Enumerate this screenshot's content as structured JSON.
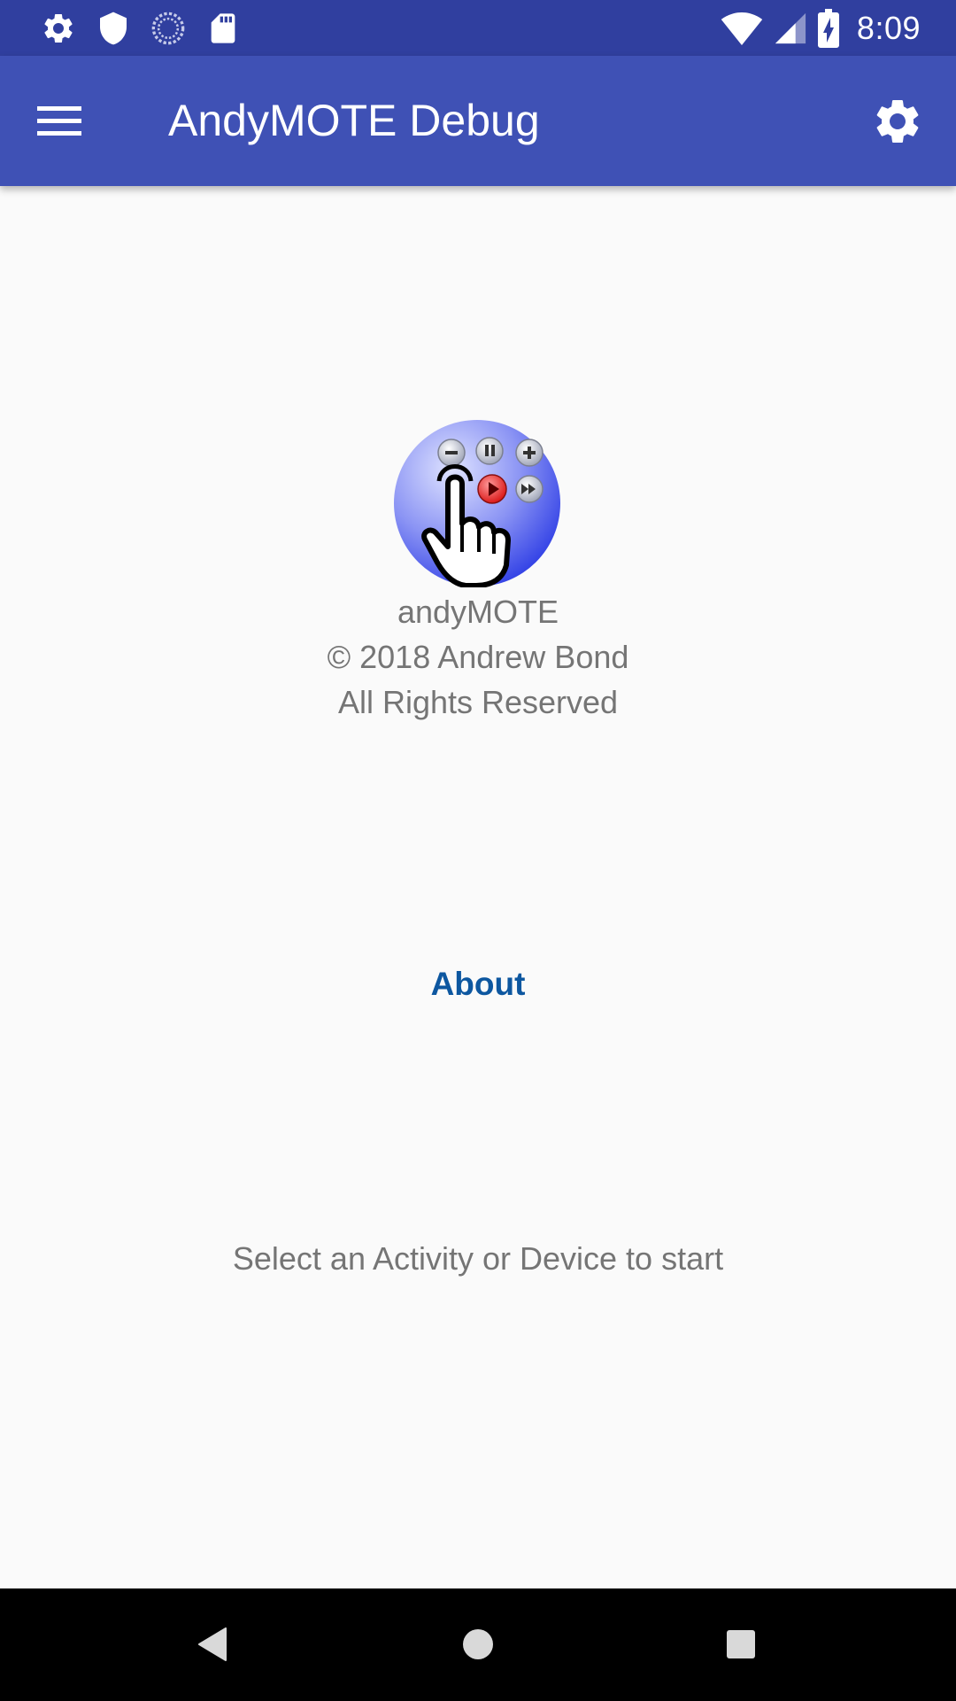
{
  "status_bar": {
    "time": "8:09",
    "left_icons": [
      "settings-icon",
      "shield-icon",
      "sync-icon",
      "sd-card-icon"
    ],
    "right_icons": [
      "wifi-icon",
      "cell-signal-icon",
      "battery-charging-icon"
    ]
  },
  "app_bar": {
    "title": "AndyMOTE Debug",
    "menu_icon": "hamburger-menu-icon",
    "settings_icon": "gear-icon",
    "color": "#3f51b5",
    "status_color": "#303f9f"
  },
  "about": {
    "app_name": "andyMOTE",
    "copyright": "© 2018 Andrew Bond",
    "rights": "All Rights Reserved",
    "about_link": "About",
    "link_color": "#0d57a0"
  },
  "hint": "Select an Activity or Device to start",
  "nav_bar": {
    "back_icon": "back-triangle-icon",
    "home_icon": "home-circle-icon",
    "recents_icon": "recents-square-icon"
  }
}
